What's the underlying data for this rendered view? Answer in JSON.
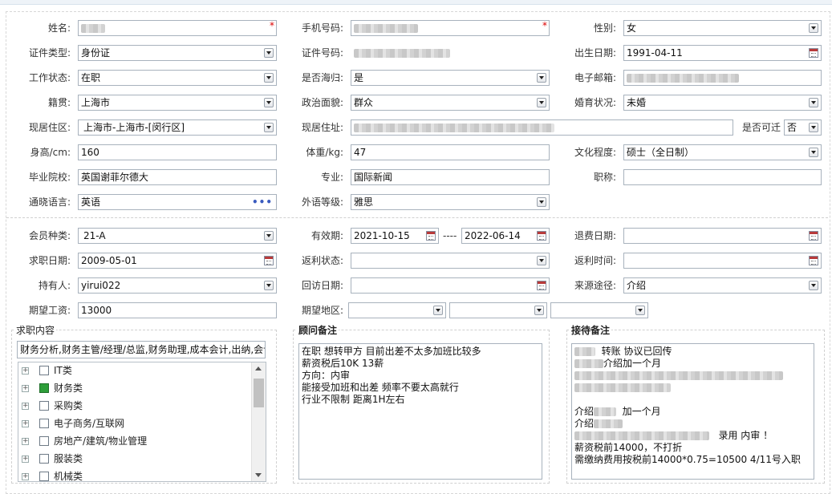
{
  "labels": {
    "name": "姓名:",
    "phone": "手机号码:",
    "gender": "性别:",
    "id_type": "证件类型:",
    "id_number": "证件号码:",
    "birth_date": "出生日期:",
    "work_status": "工作状态:",
    "overseas": "是否海归:",
    "email": "电子邮箱:",
    "native_place": "籍贯:",
    "political": "政治面貌:",
    "marital": "婚育状况:",
    "residence_area": "现居住区:",
    "residence_address": "现居住址:",
    "relocatable": "是否可迁",
    "height": "身高/cm:",
    "weight": "体重/kg:",
    "education": "文化程度:",
    "school": "毕业院校:",
    "major": "专业:",
    "title": "职称:",
    "language": "通晓语言:",
    "foreign_level": "外语等级:",
    "member_type": "会员种类:",
    "validity": "有效期:",
    "refund_date": "退费日期:",
    "job_date": "求职日期:",
    "rebate_status": "返利状态:",
    "rebate_time": "返利时间:",
    "holder": "持有人:",
    "revisit_date": "回访日期:",
    "source": "来源途径:",
    "expected_salary": "期望工资:",
    "expected_area": "期望地区:"
  },
  "values": {
    "gender": "女",
    "id_type": "身份证",
    "birth_date": "1991-04-11",
    "work_status": "在职",
    "overseas": "是",
    "native_place": "上海市",
    "political": "群众",
    "marital": "未婚",
    "residence_area": "上海市-上海市-[闵行区]",
    "relocatable": "否",
    "height": "160",
    "weight": "47",
    "education": "硕士（全日制）",
    "school": "英国谢菲尔德大",
    "major": "国际新闻",
    "title": "",
    "language": "英语",
    "language_more": "•••",
    "foreign_level": "雅思",
    "member_type": "21-A",
    "validity_from": "2021-10-15",
    "validity_sep": "----",
    "validity_to": "2022-06-14",
    "refund_date": "",
    "job_date": "2009-05-01",
    "rebate_status": "",
    "rebate_time": "",
    "holder": "yirui022",
    "revisit_date": "",
    "source": "介绍",
    "expected_salary": "13000",
    "required_mark": "*"
  },
  "job_panel": {
    "title": "求职内容",
    "summary": "财务分析,财务主管/经理/总监,财务助理,成本会计,出纳,会计",
    "categories": [
      {
        "label": "IT类",
        "checked": false
      },
      {
        "label": "财务类",
        "checked": true
      },
      {
        "label": "采购类",
        "checked": false
      },
      {
        "label": "电子商务/互联网",
        "checked": false
      },
      {
        "label": "房地产/建筑/物业管理",
        "checked": false
      },
      {
        "label": "服装类",
        "checked": false
      },
      {
        "label": "机械类",
        "checked": false
      }
    ],
    "expander": "+"
  },
  "consultant_panel": {
    "title": "顾问备注",
    "lines": [
      "在职  想转甲方  目前出差不太多加班比较多",
      "薪资税后10K  13薪",
      "方向：内审",
      "能接受加班和出差  频率不要太高就行",
      "行业不限制  距离1H左右"
    ]
  },
  "reception_panel": {
    "title": "接待备注",
    "line1": "转账  协议已回传",
    "line2": "介绍加一个月",
    "line3": "介绍",
    "line3b": "加一个月",
    "line4": "介绍",
    "line5": "录用  内审 ！",
    "line6": "薪资税前14000，不打折",
    "line7": "需缴纳费用按税前14000*0.75=10500    4/11号入职"
  }
}
